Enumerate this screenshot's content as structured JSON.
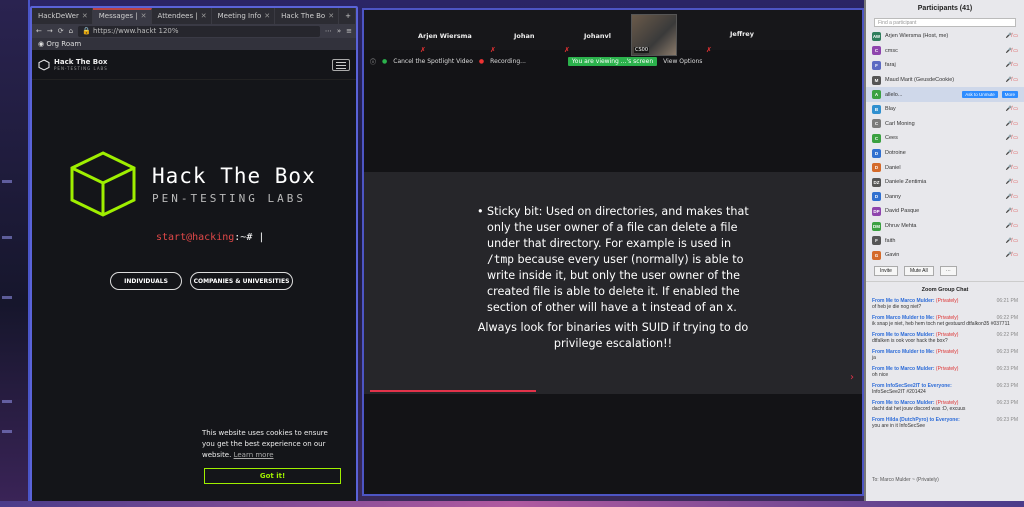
{
  "browser": {
    "tabs": [
      {
        "label": "HackDeWer",
        "active": false
      },
      {
        "label": "Messages |",
        "active": true
      },
      {
        "label": "Attendees |",
        "active": false
      },
      {
        "label": "Meeting Info",
        "active": false
      },
      {
        "label": "Hack The Bo",
        "active": false
      }
    ],
    "url": "https://www.hackt",
    "zoom": "120%",
    "bookmark": "Org Roam"
  },
  "htb": {
    "logo_name": "Hack The Box",
    "logo_sub": "PEN-TESTING LABS",
    "hero_title": "Hack The Box",
    "hero_sub": "PEN-TESTING LABS",
    "prompt_user": "start@hacking",
    "prompt_rest": ":~# |",
    "btn_individuals": "INDIVIDUALS",
    "btn_companies": "COMPANIES & UNIVERSITIES",
    "cookie_text": "This website uses cookies to ensure you get the best experience on our website.",
    "learn_more": "Learn more",
    "got_it": "Got it!"
  },
  "zoom": {
    "participants": [
      "Arjen Wiersma",
      "Johan",
      "Johanvl",
      "Jeffrey"
    ],
    "self_label": "CS00",
    "cancel_spotlight": "Cancel the Spotlight Video",
    "recording": "Recording...",
    "viewing": "You are viewing ...'s screen",
    "view_options": "View Options",
    "slide_bullet_a": "Sticky bit: Used on directories, and makes that only the user owner of a file can delete a file under that directory. For example is used in ",
    "slide_code": "/tmp",
    "slide_bullet_b": " because every user (normally) is able to write inside it, but only the user owner of the created file is able to delete it. If enabled the section of other will have a t instead of an x.",
    "slide_footer": "Always look for binaries with SUID if trying to do privilege escalation!!"
  },
  "panel": {
    "title": "Participants (41)",
    "search": "Find a participant",
    "ask_unmute": "Ask to Unmute",
    "more": "More",
    "rows": [
      {
        "initials": "AW",
        "name": "Arjen Wiersma (Host, me)",
        "color": "#2e7d5b"
      },
      {
        "initials": "C",
        "name": "cmsc",
        "color": "#8e44ad"
      },
      {
        "initials": "F",
        "name": "faraj",
        "color": "#5b6ac2"
      },
      {
        "initials": "M",
        "name": "Maud Marit (GeusdeCookie)",
        "color": "#555555"
      },
      {
        "initials": "A",
        "name": "allelo...",
        "color": "#3aa040"
      },
      {
        "initials": "B",
        "name": "Blay",
        "color": "#2f8fcf"
      },
      {
        "initials": "C",
        "name": "Carl Moning",
        "color": "#7a7a7a"
      },
      {
        "initials": "C",
        "name": "Cees",
        "color": "#3aa040"
      },
      {
        "initials": "D",
        "name": "Dotroine",
        "color": "#2f6fcf"
      },
      {
        "initials": "D",
        "name": "Daniel",
        "color": "#d46a2a"
      },
      {
        "initials": "DZ",
        "name": "Daniele Zentimia",
        "color": "#555555"
      },
      {
        "initials": "D",
        "name": "Danny",
        "color": "#2f6fcf"
      },
      {
        "initials": "DP",
        "name": "David Pasque",
        "color": "#8e44ad"
      },
      {
        "initials": "DM",
        "name": "Dhruv Mehta",
        "color": "#3aa040"
      },
      {
        "initials": "F",
        "name": "faith",
        "color": "#555555"
      },
      {
        "initials": "G",
        "name": "Gavin",
        "color": "#d46a2a"
      }
    ],
    "invite": "Invite",
    "mute_all": "Mute All",
    "chat_title": "Zoom Group Chat",
    "messages": [
      {
        "from": "From Me to Marco Mulder:",
        "priv": "(Privately)",
        "time": "06:21 PM",
        "body": "of heb je die nog niet?"
      },
      {
        "from": "From Marco Mulder to Me:",
        "priv": "(Privately)",
        "time": "06:22 PM",
        "body": "ik snap je niet, heb hem toch net gestuurd dtfalkon35 #037711"
      },
      {
        "from": "From Me to Marco Mulder:",
        "priv": "(Privately)",
        "time": "06:22 PM",
        "body": "dtfalken is ook voor hack the box?"
      },
      {
        "from": "From Marco Mulder to Me:",
        "priv": "(Privately)",
        "time": "06:23 PM",
        "body": "ja"
      },
      {
        "from": "From Me to Marco Mulder:",
        "priv": "(Privately)",
        "time": "06:23 PM",
        "body": "oh nice"
      },
      {
        "from": "From InfoSecSee2IT to Everyone:",
        "priv": "",
        "time": "06:23 PM",
        "body": "InfoSecSee2IT #201424"
      },
      {
        "from": "From Me to Marco Mulder:",
        "priv": "(Privately)",
        "time": "06:23 PM",
        "body": "dacht dat het jouw discord was :D, excuus"
      },
      {
        "from": "From Hilda (DutchPyro) to Everyone:",
        "priv": "",
        "time": "06:23 PM",
        "body": "you are in it InfoSecSee"
      }
    ],
    "to_label": "To: Marco Mulder ~ (Privately)"
  }
}
